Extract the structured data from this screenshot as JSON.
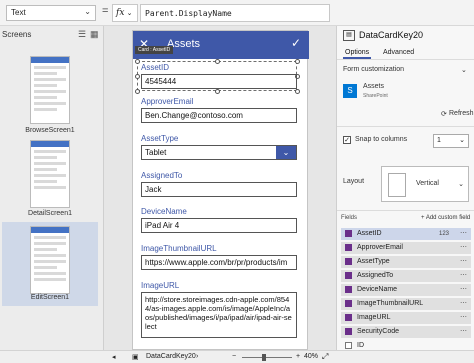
{
  "topbar": {
    "property": "Text",
    "equals": "=",
    "fx": "fx",
    "formula": "Parent.DisplayName"
  },
  "left": {
    "title": "Screens",
    "screens": [
      {
        "label": "BrowseScreen1"
      },
      {
        "label": "DetailScreen1"
      },
      {
        "label": "EditScreen1"
      }
    ]
  },
  "canvas": {
    "header_title": "Assets",
    "card_tag": "Card : AssetID",
    "fields": [
      {
        "label": "AssetID",
        "value": "4545444"
      },
      {
        "label": "ApproverEmail",
        "value": "Ben.Change@contoso.com"
      },
      {
        "label": "AssetType",
        "value": "Tablet"
      },
      {
        "label": "AssignedTo",
        "value": "Jack"
      },
      {
        "label": "DeviceName",
        "value": "iPad Air 4"
      },
      {
        "label": "ImageThumbnailURL",
        "value": "https://www.apple.com/br/pr/products/im"
      },
      {
        "label": "ImageURL",
        "value": "http://store.storeimages.cdn-apple.com/8544/as-images.apple.com/is/image/AppleInc/aos/published/images/i/pa/ipad/air/ipad-air-select"
      }
    ]
  },
  "right": {
    "title": "DataCardKey20",
    "tabs": [
      "Options",
      "Advanced"
    ],
    "form_customization": "Form customization",
    "source_name": "Assets",
    "source_sub": "SharePoint",
    "refresh": "Refresh",
    "snap_label": "Snap to columns",
    "columns_value": "1",
    "layout_label": "Layout",
    "layout_value": "Vertical",
    "fields_label": "Fields",
    "add_field": "+ Add custom field",
    "field_list": [
      {
        "name": "AssetID",
        "type": "123"
      },
      {
        "name": "ApproverEmail",
        "type": ""
      },
      {
        "name": "AssetType",
        "type": ""
      },
      {
        "name": "AssignedTo",
        "type": ""
      },
      {
        "name": "DeviceName",
        "type": ""
      },
      {
        "name": "ImageThumbnailURL",
        "type": ""
      },
      {
        "name": "ImageURL",
        "type": ""
      },
      {
        "name": "SecurityCode",
        "type": ""
      },
      {
        "name": "ID",
        "type": ""
      }
    ]
  },
  "bottom": {
    "card_name": "DataCardKey20",
    "zoom": "40%"
  },
  "colors": {
    "accent": "#3f58a8",
    "field_check": "#6b2f8a"
  }
}
